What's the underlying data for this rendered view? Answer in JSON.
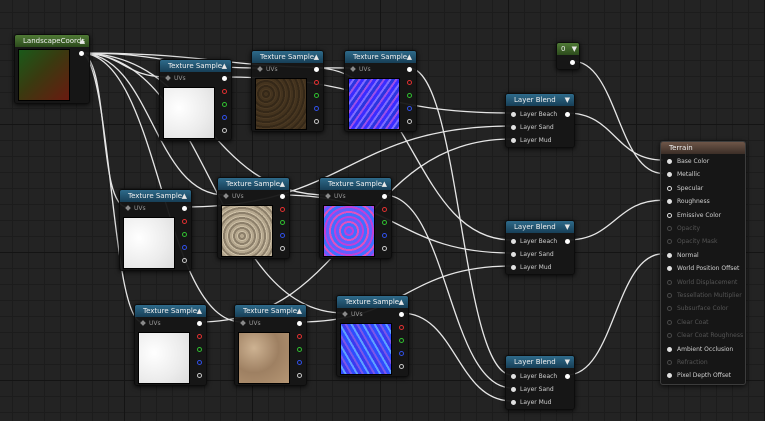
{
  "app": "Material Editor",
  "colors": {
    "wire": "#e6e6e6",
    "grid_bg": "#232323",
    "texture_header": "#2e6a8a",
    "coords_header": "#4f7a35",
    "result_header": "#6e5648"
  },
  "coords_node": {
    "title": "LandscapeCoords"
  },
  "constant_node": {
    "value": "0"
  },
  "texture_sample": {
    "title": "Texture Sample",
    "uv_label": "UVs"
  },
  "layer_blend": {
    "title": "Layer Blend",
    "inputs": [
      "Layer Beach",
      "Layer Sand",
      "Layer Mud"
    ]
  },
  "result_node": {
    "title": "Terrain",
    "inputs": [
      {
        "label": "Base Color",
        "enabled": true
      },
      {
        "label": "Metallic",
        "enabled": true
      },
      {
        "label": "Specular",
        "enabled": true
      },
      {
        "label": "Roughness",
        "enabled": true
      },
      {
        "label": "Emissive Color",
        "enabled": true
      },
      {
        "label": "Opacity",
        "enabled": false
      },
      {
        "label": "Opacity Mask",
        "enabled": false
      },
      {
        "label": "Normal",
        "enabled": true
      },
      {
        "label": "World Position Offset",
        "enabled": true
      },
      {
        "label": "World Displacement",
        "enabled": false
      },
      {
        "label": "Tessellation Multiplier",
        "enabled": false
      },
      {
        "label": "Subsurface Color",
        "enabled": false
      },
      {
        "label": "Clear Coat",
        "enabled": false
      },
      {
        "label": "Clear Coat Roughness",
        "enabled": false
      },
      {
        "label": "Ambient Occlusion",
        "enabled": true
      },
      {
        "label": "Refraction",
        "enabled": false
      },
      {
        "label": "Pixel Depth Offset",
        "enabled": true
      }
    ]
  }
}
